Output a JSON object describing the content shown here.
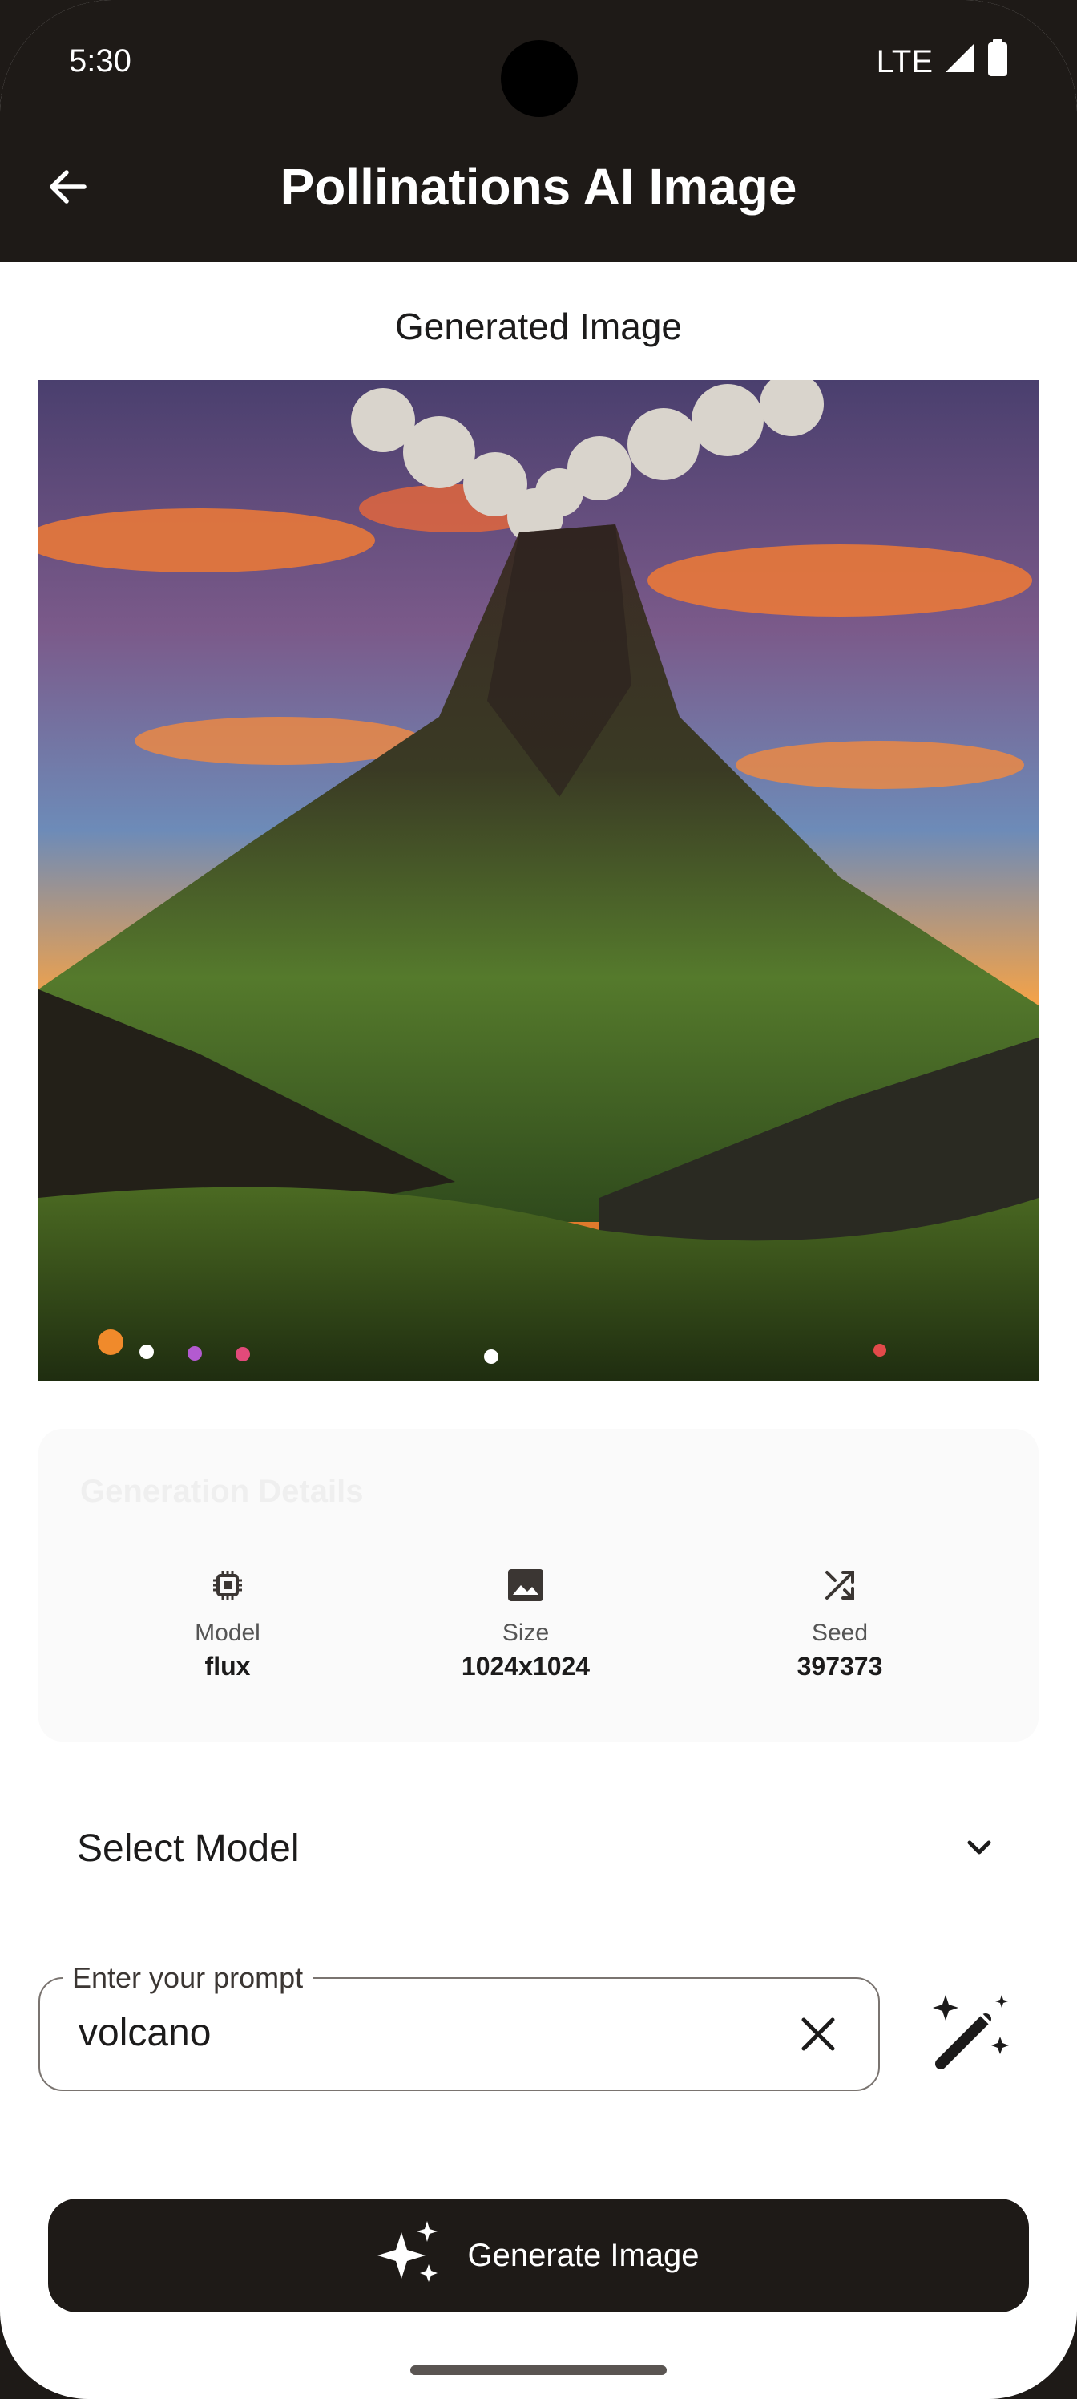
{
  "status_bar": {
    "time": "5:30",
    "network": "LTE"
  },
  "app_bar": {
    "title": "Pollinations AI Image",
    "back_icon": "arrow-back-icon"
  },
  "main": {
    "section_title": "Generated Image",
    "image": {
      "description": "volcano"
    }
  },
  "details": {
    "title": "Generation Details",
    "items": [
      {
        "icon": "chip-icon",
        "label": "Model",
        "value": "flux"
      },
      {
        "icon": "image-icon",
        "label": "Size",
        "value": "1024x1024"
      },
      {
        "icon": "shuffle-icon",
        "label": "Seed",
        "value": "397373"
      }
    ]
  },
  "model_select": {
    "label": "Select Model",
    "icon": "chevron-down-icon"
  },
  "prompt": {
    "label": "Enter your prompt",
    "value": "volcano",
    "clear_icon": "close-icon",
    "enhance_icon": "magic-wand-icon"
  },
  "generate": {
    "label": "Generate Image",
    "icon": "sparkles-icon"
  },
  "colors": {
    "bar_bg": "#1e1a17",
    "surface": "#ffffff",
    "card_bg": "#fafafa"
  }
}
